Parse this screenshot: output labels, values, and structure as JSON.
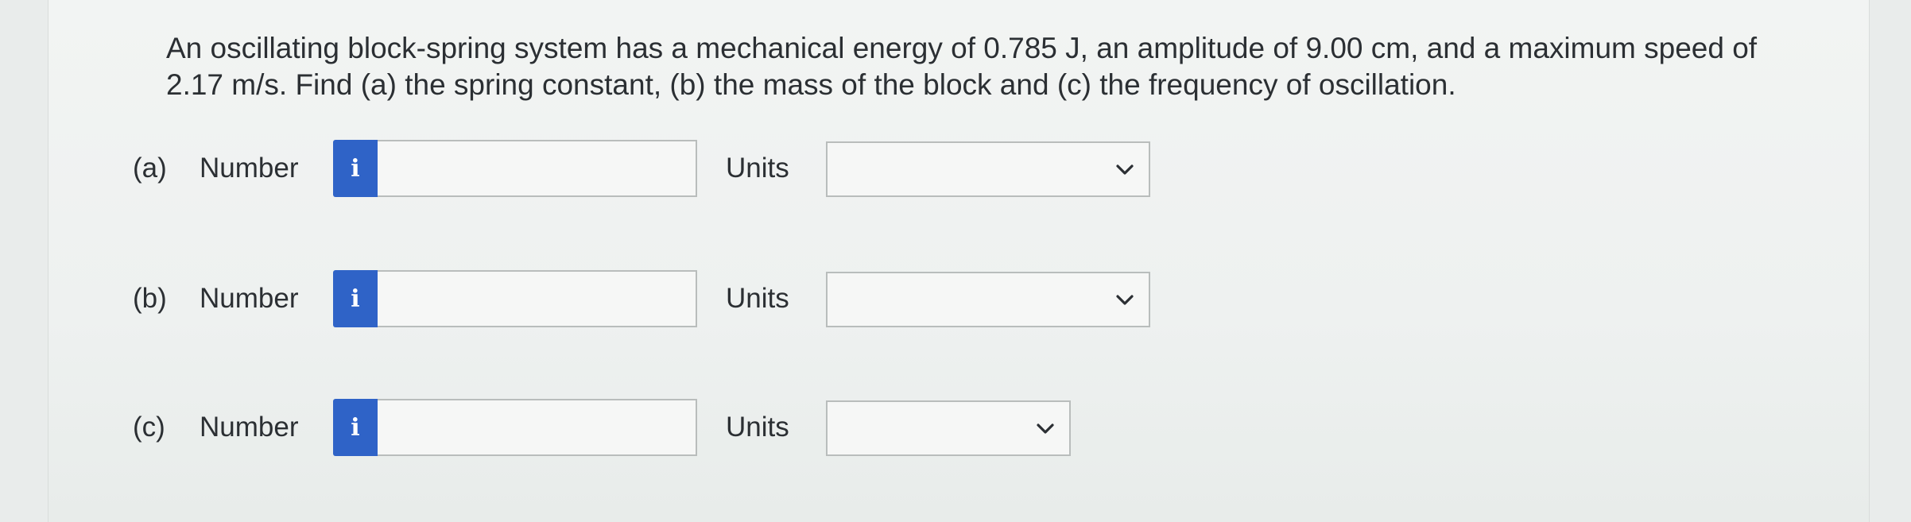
{
  "question": {
    "text": "An oscillating block-spring system has a mechanical energy of 0.785 J, an amplitude of 9.00 cm, and a maximum speed of 2.17 m/s. Find (a) the spring constant, (b) the mass of the block and (c) the frequency of oscillation."
  },
  "parts": [
    {
      "label": "(a)",
      "number_label": "Number",
      "info_glyph": "i",
      "number_value": "",
      "units_label": "Units",
      "units_value": ""
    },
    {
      "label": "(b)",
      "number_label": "Number",
      "info_glyph": "i",
      "number_value": "",
      "units_label": "Units",
      "units_value": ""
    },
    {
      "label": "(c)",
      "number_label": "Number",
      "info_glyph": "i",
      "number_value": "",
      "units_label": "Units",
      "units_value": ""
    }
  ],
  "icons": {
    "info": "info-icon",
    "dropdown": "chevron-down-icon"
  },
  "colors": {
    "info_button": "#2f63c7",
    "text": "#2b2f33",
    "border": "#b9bdbc"
  }
}
